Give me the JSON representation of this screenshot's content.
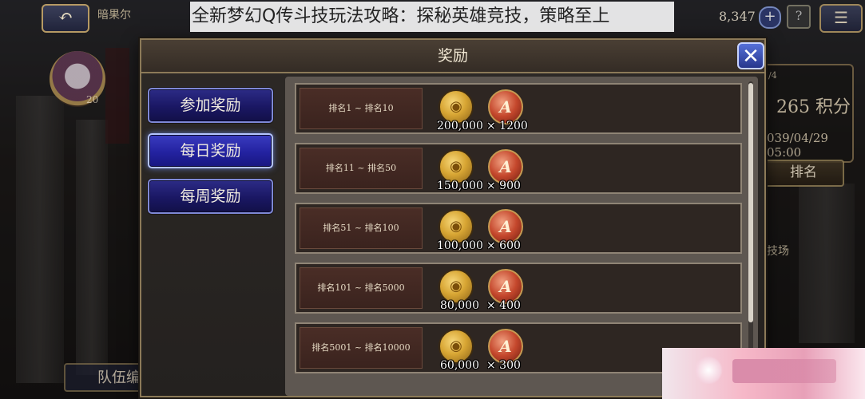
{
  "caption": "全新梦幻Q传斗技玩法攻略：探秘英雄竞技，策略至上",
  "topbar": {
    "back_icon": "↶",
    "player_name": "暗果尔",
    "currency_value": "8,347",
    "plus_icon": "+",
    "help_icon": "?",
    "menu_icon": "☰"
  },
  "left": {
    "avatar_level": "20",
    "team_button": "队伍编"
  },
  "right": {
    "tiny": "/4",
    "score": "265 积分",
    "date": "039/04/29 05:00",
    "rank_button": "排名",
    "arena_text": "技场"
  },
  "modal": {
    "title": "奖励",
    "close_icon": "✕",
    "tabs": [
      {
        "label": "参加奖励",
        "active": false
      },
      {
        "label": "每日奖励",
        "active": true
      },
      {
        "label": "每周奖励",
        "active": false
      }
    ],
    "rewards": [
      {
        "rank": "排名1 ~ 排名10",
        "gold": "200,000",
        "medal": "× 1200"
      },
      {
        "rank": "排名11 ~ 排名50",
        "gold": "150,000",
        "medal": "× 900"
      },
      {
        "rank": "排名51 ~ 排名100",
        "gold": "100,000",
        "medal": "× 600"
      },
      {
        "rank": "排名101 ~ 排名5000",
        "gold": "80,000",
        "medal": "× 400"
      },
      {
        "rank": "排名5001 ~ 排名10000",
        "gold": "60,000",
        "medal": "× 300"
      }
    ],
    "gold_icon": "gold-coin-icon",
    "medal_icon": "arena-medal-icon",
    "medal_letter": "A",
    "gold_glyph": "◉"
  },
  "colors": {
    "tab_blue": "#1a1763",
    "close_blue": "#3a4fc0",
    "frame_gold": "#8c7a58"
  }
}
